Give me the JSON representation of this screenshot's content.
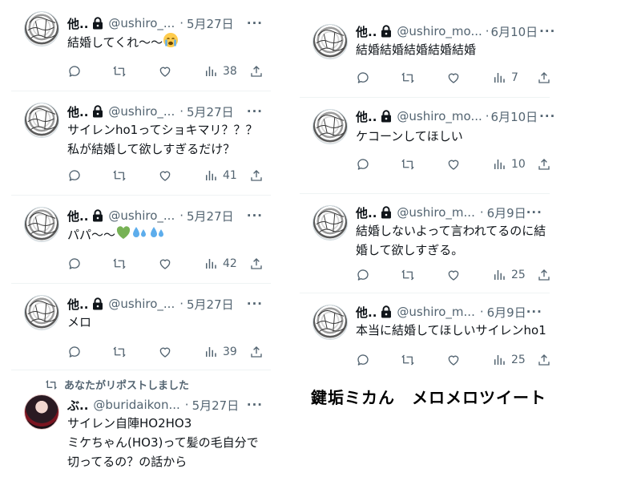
{
  "left_column": {
    "tweets": [
      {
        "name": "他..",
        "handle": "@ushiro_...",
        "separator": "·",
        "date": "5月27日",
        "more": "···",
        "lines": [
          "結婚してくれ〜〜"
        ],
        "emoji": "crying-face",
        "views": "38"
      },
      {
        "name": "他..",
        "handle": "@ushiro_...",
        "separator": "·",
        "date": "5月27日",
        "more": "···",
        "lines": [
          "サイレンho1ってショキマリ？？？",
          "私が結婚して欲しすぎるだけ？"
        ],
        "views": "41"
      },
      {
        "name": "他..",
        "handle": "@ushiro_...",
        "separator": "·",
        "date": "5月27日",
        "more": "···",
        "lines": [
          "パパ〜〜"
        ],
        "emoji": "green-heart-sweat-droplets",
        "views": "42"
      },
      {
        "name": "他..",
        "handle": "@ushiro_...",
        "separator": "·",
        "date": "5月27日",
        "more": "···",
        "lines": [
          "メロ"
        ],
        "views": "39"
      }
    ],
    "retweet_note": "あなたがリポストしました",
    "retweeted": {
      "name": "ぶ..",
      "handle": "@buridaikon...",
      "separator": "·",
      "date": "5月27日",
      "more": "···",
      "lines": [
        "サイレン自陣HO2HO3",
        "ミケちゃん(HO3)って髪の毛自分で",
        "切ってるの？の話から"
      ]
    }
  },
  "right_column": {
    "tweets": [
      {
        "name": "他..",
        "handle": "@ushiro_mo...",
        "separator": "·",
        "date": "6月10日",
        "more": "···",
        "lines": [
          "結婚結婚結婚結婚結婚"
        ],
        "views": "7"
      },
      {
        "name": "他..",
        "handle": "@ushiro_mo...",
        "separator": "·",
        "date": "6月10日",
        "more": "···",
        "lines": [
          "ケコーンしてほしい"
        ],
        "views": "10"
      },
      {
        "name": "他..",
        "handle": "@ushiro_m...",
        "separator": "·",
        "date": "6月9日",
        "more": "···",
        "lines": [
          "結婚しないよって言われてるのに結",
          "婚して欲しすぎる。"
        ],
        "views": "25"
      },
      {
        "name": "他..",
        "handle": "@ushiro_m...",
        "separator": "·",
        "date": "6月9日",
        "more": "···",
        "lines": [
          "本当に結婚してほしいサイレンho1"
        ],
        "views": "25"
      }
    ]
  },
  "caption": "鍵垢ミカん　メロメロツイート",
  "colors": {
    "text": "#0f1419",
    "muted": "#536471",
    "border": "#eff3f4",
    "heart_emoji": "#77b255",
    "droplet_emoji": "#5dadec"
  },
  "icons": [
    "lock-icon",
    "reply-icon",
    "repost-icon",
    "like-icon",
    "views-icon",
    "share-icon",
    "more-icon"
  ]
}
